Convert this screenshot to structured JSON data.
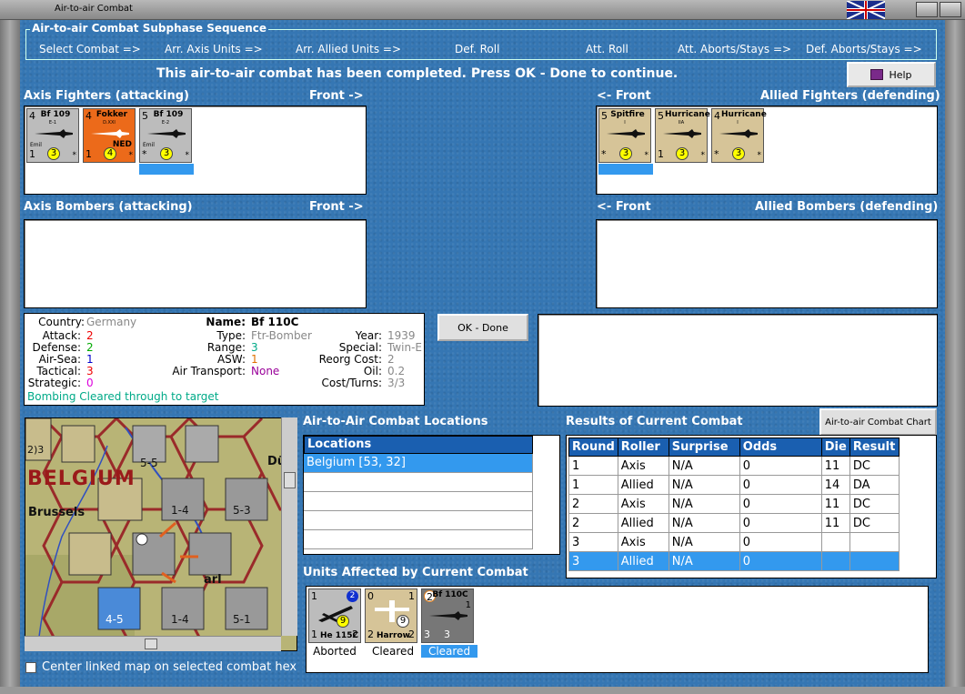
{
  "window": {
    "title": "Air-to-air Combat"
  },
  "subphase": {
    "legend": "Air-to-air Combat Subphase Sequence",
    "steps": [
      "Select Combat =>",
      "Arr. Axis Units =>",
      "Arr. Allied Units =>",
      "Def. Roll",
      "Att. Roll",
      "Att. Aborts/Stays =>",
      "Def. Aborts/Stays =>"
    ]
  },
  "status_message": "This air-to-air combat has been completed.  Press OK - Done to continue.",
  "help_label": "Help",
  "panels": {
    "axis_fighters": "Axis Fighters (attacking)",
    "axis_fighters_front": "Front ->",
    "allied_fighters": "Allied Fighters (defending)",
    "allied_fighters_front": "<- Front",
    "axis_bombers": "Axis Bombers (attacking)",
    "axis_bombers_front": "Front ->",
    "allied_bombers": "Allied Bombers (defending)",
    "allied_bombers_front": "<- Front"
  },
  "axis_fighter_units": [
    {
      "name": "Bf 109",
      "sub": "E-1",
      "tl": "4",
      "bl": "1",
      "dot": "3",
      "small": "Emil",
      "color": "gray"
    },
    {
      "name": "Fokker",
      "sub": "D.XXI",
      "tl": "4",
      "bl": "1",
      "dot": "4",
      "small": "",
      "ned": "NED",
      "color": "orange"
    },
    {
      "name": "Bf 109",
      "sub": "E-2",
      "tl": "5",
      "bl": "*",
      "dot": "3",
      "small": "Emil",
      "color": "gray"
    }
  ],
  "allied_fighter_units": [
    {
      "name": "Spitfire",
      "sub": "I",
      "tl": "5",
      "bl": "*",
      "dot": "3",
      "color": "tan"
    },
    {
      "name": "Hurricane",
      "sub": "IIA",
      "tl": "5",
      "bl": "1",
      "dot": "3",
      "color": "tan"
    },
    {
      "name": "Hurricane",
      "sub": "I",
      "tl": "4",
      "bl": "*",
      "dot": "3",
      "color": "tan"
    }
  ],
  "unit_info": {
    "country_label": "Country:",
    "country": "Germany",
    "attack_label": "Attack:",
    "attack": "2",
    "defense_label": "Defense:",
    "defense": "2",
    "airsea_label": "Air-Sea:",
    "airsea": "1",
    "tactical_label": "Tactical:",
    "tactical": "3",
    "strategic_label": "Strategic:",
    "strategic": "0",
    "name_label": "Name:",
    "name": "Bf 110C",
    "type_label": "Type:",
    "type": "Ftr-Bomber",
    "range_label": "Range:",
    "range": "3",
    "asw_label": "ASW:",
    "asw": "1",
    "airtransport_label": "Air Transport:",
    "airtransport": "None",
    "year_label": "Year:",
    "year": "1939",
    "special_label": "Special:",
    "special": "Twin-E",
    "reorg_label": "Reorg Cost:",
    "reorg": "2",
    "oil_label": "Oil:",
    "oil": "0.2",
    "costturns_label": "Cost/Turns:",
    "costturns": "3/3",
    "bombing_status": "Bombing Cleared through to target"
  },
  "ok_label": "OK - Done",
  "chart_button_label": "Air-to-air Combat Chart",
  "locations": {
    "title": "Air-to-Air Combat Locations",
    "header": "Locations",
    "rows": [
      "Belgium [53, 32]",
      "",
      "",
      "",
      ""
    ]
  },
  "results": {
    "title": "Results of Current Combat",
    "columns": [
      "Round",
      "Roller",
      "Surprise",
      "Odds",
      "Die",
      "Result"
    ],
    "rows": [
      [
        "1",
        "Axis",
        "N/A",
        "0",
        "11",
        "DC"
      ],
      [
        "1",
        "Allied",
        "N/A",
        "0",
        "14",
        "DA"
      ],
      [
        "2",
        "Axis",
        "N/A",
        "0",
        "11",
        "DC"
      ],
      [
        "2",
        "Allied",
        "N/A",
        "0",
        "11",
        "DC"
      ],
      [
        "3",
        "Axis",
        "N/A",
        "0",
        "",
        ""
      ],
      [
        "3",
        "Allied",
        "N/A",
        "0",
        "",
        ""
      ]
    ]
  },
  "affected": {
    "title": "Units Affected by Current Combat",
    "units": [
      {
        "name": "He 115C",
        "tl": "1",
        "tr": "2",
        "bl": "1",
        "br": "2",
        "dot": "9",
        "caption": "Aborted",
        "color": "gray"
      },
      {
        "name": "Harrow",
        "tl": "0",
        "tr": "1",
        "bl": "2",
        "br": "2",
        "dot": "9",
        "caption": "Cleared",
        "color": "tan"
      },
      {
        "name": "Bf 110C",
        "tl": "2",
        "tr": "1",
        "bl": "3",
        "br": "3",
        "dot": "",
        "caption": "Cleared",
        "color": "gray"
      }
    ]
  },
  "map": {
    "labels": [
      "BELGIUM",
      "Brussels",
      "Dü",
      "arl"
    ],
    "hex_values": [
      "5-5",
      "5-3",
      "1-4",
      "1-4",
      "5-1",
      "4-5",
      "2)3"
    ]
  },
  "checkbox_label": "Center linked map on selected combat hex",
  "colors": {
    "background": "#3576b3",
    "selection": "#3399ee",
    "table_header": "#1a5fb0"
  }
}
